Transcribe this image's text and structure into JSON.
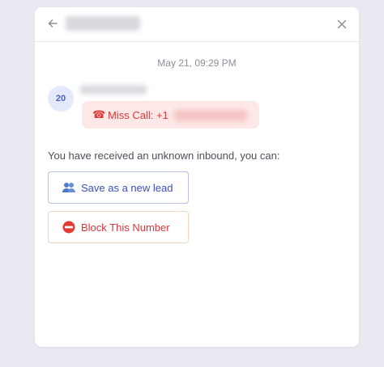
{
  "conversation": {
    "timestamp": "May 21, 09:29 PM"
  },
  "message": {
    "avatar_initials": "20",
    "call_label": "Miss Call: +1"
  },
  "inbound": {
    "prompt": "You have received an unknown inbound, you can:",
    "save_lead_label": "Save as a new lead",
    "block_label": "Block This Number"
  },
  "icons": {
    "back": "arrow-left-icon",
    "close": "close-icon",
    "call": "telephone-icon",
    "lead": "users-icon",
    "block": "no-entry-icon"
  },
  "colors": {
    "background": "#e9eaf1",
    "accent_blue": "#3b4fc0",
    "danger_red": "#d9363e",
    "bubble_bg": "#fde7e7"
  }
}
